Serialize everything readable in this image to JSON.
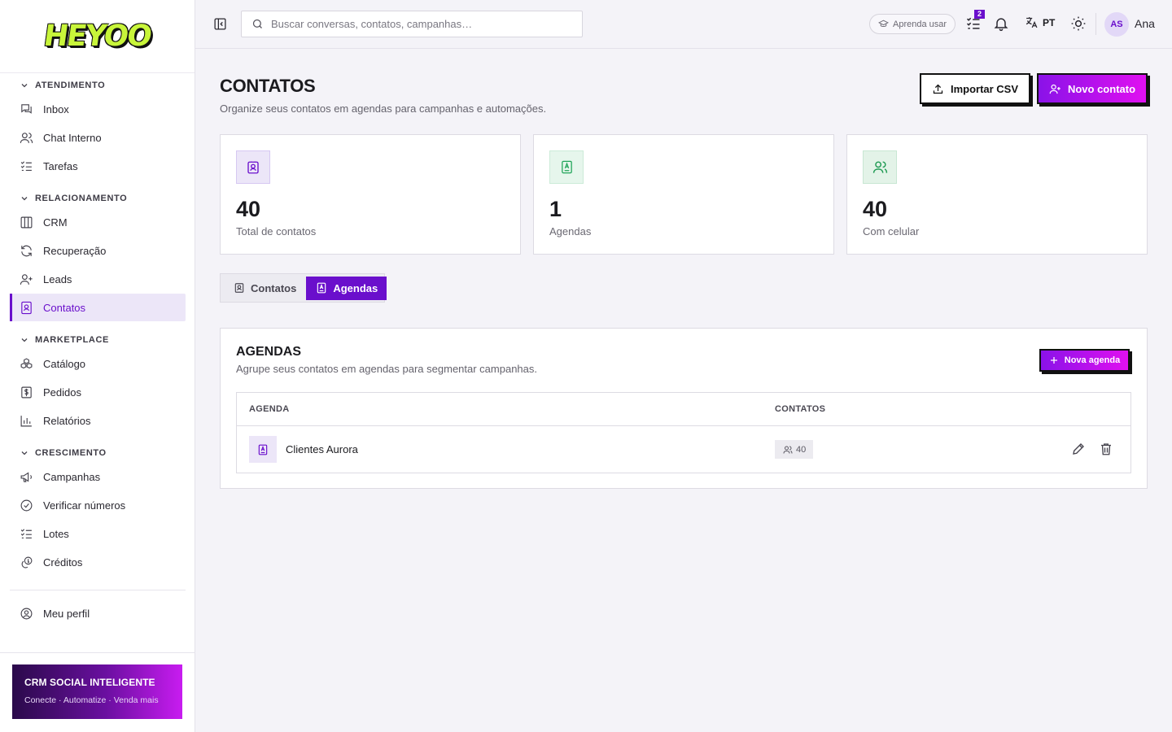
{
  "app": {
    "logo_text": "HEYOO"
  },
  "sidebar": {
    "sections": [
      {
        "title": "ATENDIMENTO",
        "items": [
          {
            "label": "Inbox",
            "icon": "chat-icon"
          },
          {
            "label": "Chat Interno",
            "icon": "users-icon"
          },
          {
            "label": "Tarefas",
            "icon": "list-check-icon"
          }
        ]
      },
      {
        "title": "RELACIONAMENTO",
        "items": [
          {
            "label": "CRM",
            "icon": "columns-icon"
          },
          {
            "label": "Recuperação",
            "icon": "refresh-icon"
          },
          {
            "label": "Leads",
            "icon": "user-plus-icon"
          },
          {
            "label": "Contatos",
            "icon": "contact-book-icon",
            "active": true
          }
        ]
      },
      {
        "title": "MARKETPLACE",
        "items": [
          {
            "label": "Catálogo",
            "icon": "boxes-icon"
          },
          {
            "label": "Pedidos",
            "icon": "dollar-receipt-icon"
          },
          {
            "label": "Relatórios",
            "icon": "bar-chart-icon"
          }
        ]
      },
      {
        "title": "CRESCIMENTO",
        "items": [
          {
            "label": "Campanhas",
            "icon": "megaphone-icon"
          },
          {
            "label": "Verificar números",
            "icon": "check-circle-icon"
          },
          {
            "label": "Lotes",
            "icon": "list-check-icon"
          },
          {
            "label": "Créditos",
            "icon": "coins-icon"
          }
        ]
      }
    ],
    "profile": {
      "label": "Meu perfil",
      "icon": "user-circle-icon"
    },
    "promo": {
      "title": "CRM SOCIAL INTELIGENTE",
      "subtitle": "Conecte · Automatize · Venda mais"
    }
  },
  "topbar": {
    "search_placeholder": "Buscar conversas, contatos, campanhas…",
    "learn_label": "Aprenda usar",
    "tasks_badge": "2",
    "language": "PT",
    "user_initials": "AS",
    "user_name": "Ana"
  },
  "page": {
    "title": "CONTATOS",
    "subtitle": "Organize seus contatos em agendas para campanhas e automações.",
    "import_label": "Importar CSV",
    "new_contact_label": "Novo contato"
  },
  "stats": [
    {
      "value": "40",
      "label": "Total de contatos",
      "icon": "contact-card-icon",
      "bg": "#ece6f8",
      "color": "#6a0fcc"
    },
    {
      "value": "1",
      "label": "Agendas",
      "icon": "address-book-icon",
      "bg": "#e6f6ec",
      "color": "#22a55a"
    },
    {
      "value": "40",
      "label": "Com celular",
      "icon": "users-icon",
      "bg": "#e3f3e8",
      "color": "#1e9a52"
    }
  ],
  "tabs": [
    {
      "label": "Contatos",
      "active": false
    },
    {
      "label": "Agendas",
      "active": true
    }
  ],
  "agendas_panel": {
    "title": "AGENDAS",
    "subtitle": "Agrupe seus contatos em agendas para segmentar campanhas.",
    "new_label": "Nova agenda",
    "columns": [
      "AGENDA",
      "CONTATOS"
    ],
    "rows": [
      {
        "name": "Clientes Aurora",
        "count": "40"
      }
    ]
  },
  "colors": {
    "accent": "#6a0fcc",
    "accent_gradient_end": "#e010f0",
    "logo": "#c8f53a"
  }
}
